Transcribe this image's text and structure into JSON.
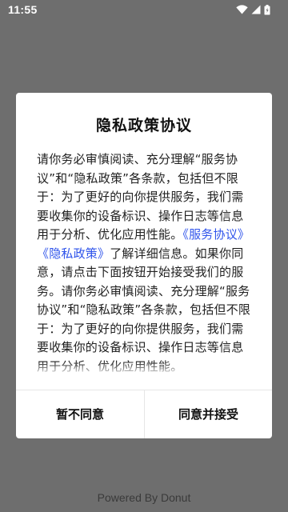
{
  "status_bar": {
    "time": "11:55",
    "icons": [
      "wifi-icon",
      "signal-icon",
      "battery-icon"
    ]
  },
  "dialog": {
    "title": "隐私政策协议",
    "body": {
      "part1": "请你务必审慎阅读、充分理解“服务协议”和“隐私政策”各条款，包括但不限于：为了更好的向你提供服务，我们需要收集你的设备标识、操作日志等信息用于分析、优化应用性能。",
      "link_service": "《服务协议》",
      "link_privacy": "《隐私政策》",
      "part2": "了解详细信息。如果你同意，请点击下面按钮开始接受我们的服务。请你务必审慎阅读、充分理解“服务协议”和“隐私政策”各条款，包括但不限于：为了更好的向你提供服务，我们需要收集你的设备标识、操作日志等信息用于分析、优化应用性能。"
    },
    "decline_label": "暂不同意",
    "accept_label": "同意并接受"
  },
  "footer": {
    "text": "Powered By Donut"
  },
  "colors": {
    "scrim": "#6e6e6e",
    "link": "#2f54eb",
    "dialog_bg": "#ffffff"
  }
}
